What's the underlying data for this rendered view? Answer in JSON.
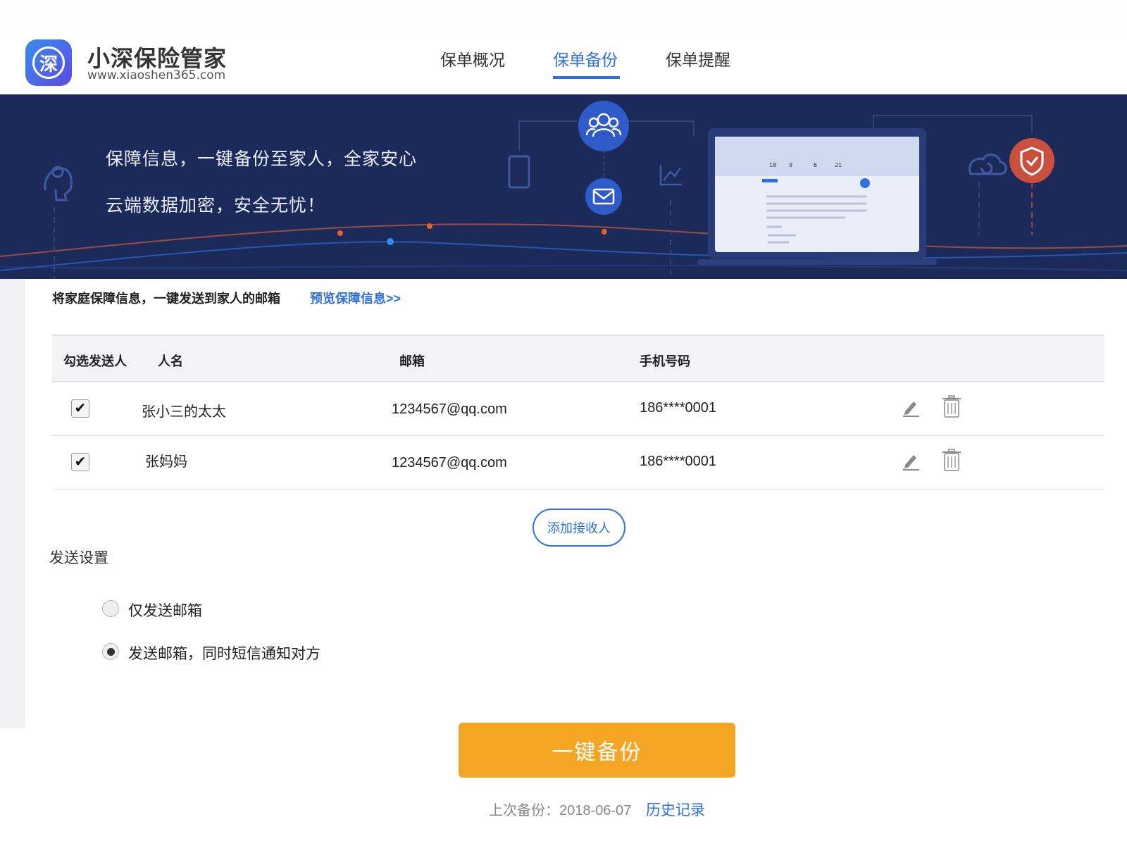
{
  "brand": {
    "logo_char": "深",
    "name": "小深保险管家",
    "url": "www.xiaoshen365.com"
  },
  "nav": {
    "items": [
      {
        "label": "保单概况",
        "active": false
      },
      {
        "label": "保单备份",
        "active": true
      },
      {
        "label": "保单提醒",
        "active": false
      }
    ]
  },
  "banner": {
    "line1": "保障信息，一键备份至家人，全家安心",
    "line2": "云端数据加密，安全无忧！",
    "mockup": {
      "stats": [
        "18",
        "9",
        "6",
        "21"
      ]
    }
  },
  "intro": {
    "text": "将家庭保障信息，一键发送到家人的邮箱",
    "preview_link": "预览保障信息>>"
  },
  "table": {
    "headers": [
      "勾选发送人",
      "人名",
      "邮箱",
      "手机号码"
    ],
    "rows": [
      {
        "checked": true,
        "name": "张小三的太太",
        "email": "1234567@qq.com",
        "phone": "186****0001"
      },
      {
        "checked": true,
        "name": "张妈妈",
        "email": "1234567@qq.com",
        "phone": "186****0001"
      }
    ]
  },
  "add_recipient_label": "添加接收人",
  "send_settings": {
    "title": "发送设置",
    "options": [
      {
        "label": "仅发送邮箱",
        "selected": false
      },
      {
        "label": "发送邮箱，同时短信通知对方",
        "selected": true
      }
    ]
  },
  "backup_button_label": "一键备份",
  "last_backup": {
    "text": "上次备份：2018-06-07",
    "history_link": "历史记录"
  },
  "colors": {
    "accent_blue": "#2f6fe0",
    "banner_bg": "#1c2a5a",
    "backup_orange": "#f5a524",
    "shield_red": "#c8503d"
  },
  "icons": {
    "check": "✔",
    "edit": "pencil-icon",
    "delete": "trash-icon",
    "family": "family-icon",
    "mail": "mail-icon",
    "shield": "shield-check-icon",
    "cloud": "cloud-sync-icon"
  }
}
